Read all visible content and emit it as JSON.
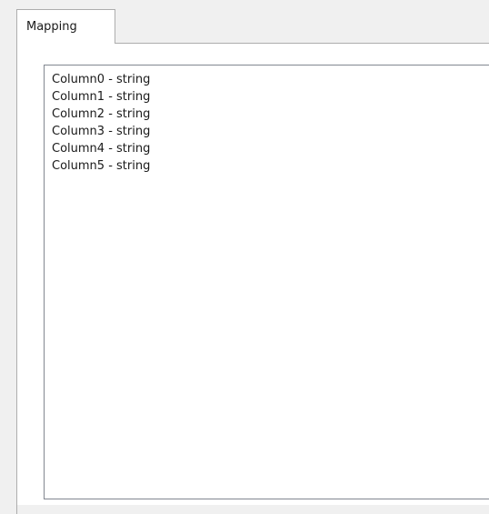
{
  "tabs": [
    {
      "label": "Mapping",
      "selected": true
    }
  ],
  "mapping_list": {
    "items": [
      "Column0 - string",
      "Column1 - string",
      "Column2 - string",
      "Column3 - string",
      "Column4 - string",
      "Column5 - string"
    ]
  }
}
